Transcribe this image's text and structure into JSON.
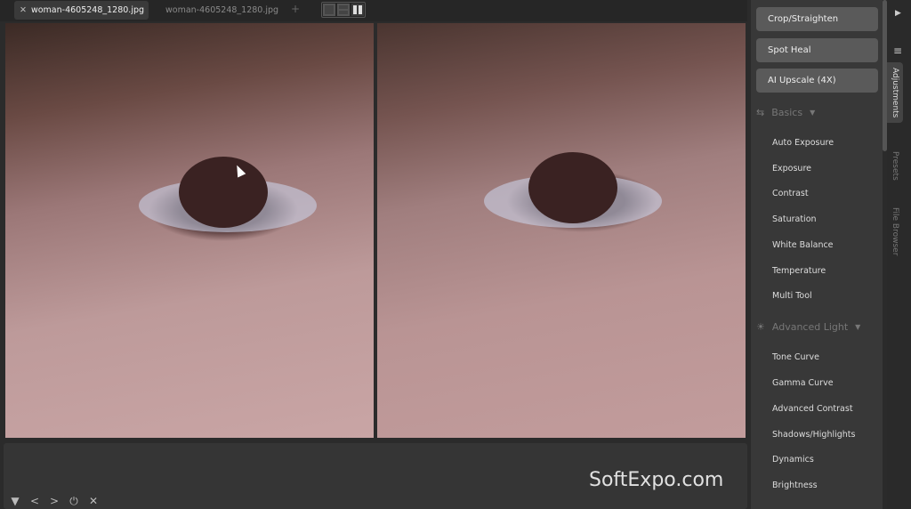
{
  "tabs": [
    {
      "label": "woman-4605248_1280.jpg",
      "active": true
    },
    {
      "label": "woman-4605248_1280.jpg",
      "active": false
    }
  ],
  "add_tab": "+",
  "view_modes": [
    "single-view-icon",
    "split-horizontal-icon",
    "split-vertical-icon"
  ],
  "tools": {
    "crop": "Crop/Straighten",
    "spot_heal": "Spot Heal",
    "ai_upscale": "AI Upscale (4X)"
  },
  "sections": [
    {
      "title": "Basics",
      "icon": "sliders-icon",
      "items": [
        "Auto Exposure",
        "Exposure",
        "Contrast",
        "Saturation",
        "White Balance",
        "Temperature",
        "Multi Tool"
      ]
    },
    {
      "title": "Advanced Light",
      "icon": "sun-icon",
      "items": [
        "Tone Curve",
        "Gamma Curve",
        "Advanced Contrast",
        "Shadows/Highlights",
        "Dynamics",
        "Brightness"
      ]
    }
  ],
  "side_tabs": {
    "adjustments": "Adjustments",
    "presets": "Presets",
    "file_browser": "File Browser"
  },
  "watermark": "SoftExpo.com",
  "colors": {
    "button": "#5a5a5a",
    "panel": "#383838",
    "background": "#2b2b2b"
  }
}
